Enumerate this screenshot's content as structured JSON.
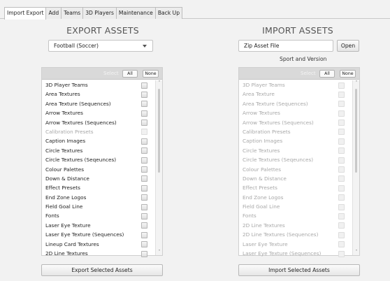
{
  "tabs": [
    "Import Export",
    "Add",
    "Teams",
    "3D Players",
    "Maintenance",
    "Back Up"
  ],
  "export": {
    "heading": "EXPORT ASSETS",
    "dropdown_value": "Football (Soccer)",
    "select_label": "Select",
    "all_label": "All",
    "none_label": "None",
    "items": [
      {
        "label": "3D Player Teams",
        "enabled": true
      },
      {
        "label": "Area Textures",
        "enabled": true
      },
      {
        "label": "Area Texture (Sequences)",
        "enabled": true
      },
      {
        "label": "Arrow Textures",
        "enabled": true
      },
      {
        "label": "Arrow Textures (Sequences)",
        "enabled": true
      },
      {
        "label": "Calibration Presets",
        "enabled": false
      },
      {
        "label": "Caption Images",
        "enabled": true
      },
      {
        "label": "Circle Textures",
        "enabled": true
      },
      {
        "label": "Circle Textures (Seqeunces)",
        "enabled": true
      },
      {
        "label": "Colour Palettes",
        "enabled": true
      },
      {
        "label": "Down & Distance",
        "enabled": true
      },
      {
        "label": "Effect Presets",
        "enabled": true
      },
      {
        "label": "End Zone Logos",
        "enabled": true
      },
      {
        "label": "Field Goal Line",
        "enabled": true
      },
      {
        "label": "Fonts",
        "enabled": true
      },
      {
        "label": "Laser Eye Texture",
        "enabled": true
      },
      {
        "label": "Laser Eye Texture (Sequences)",
        "enabled": true
      },
      {
        "label": "Lineup Card Textures",
        "enabled": true
      },
      {
        "label": "2D Line Textures",
        "enabled": true
      }
    ],
    "button": "Export Selected Assets"
  },
  "import": {
    "heading": "IMPORT ASSETS",
    "file_value": "Zip Asset File",
    "open_label": "Open",
    "sport_version_label": "Sport and Version",
    "select_label": "Select",
    "all_label": "All",
    "none_label": "None",
    "items": [
      {
        "label": "3D Player Teams",
        "enabled": false
      },
      {
        "label": "Area Texture",
        "enabled": false
      },
      {
        "label": "Area Texture (Sequences)",
        "enabled": false
      },
      {
        "label": "Arrow Textures",
        "enabled": false
      },
      {
        "label": "Arrow Textures (Sequences)",
        "enabled": false
      },
      {
        "label": "Calibration Presets",
        "enabled": false
      },
      {
        "label": "Caption Images",
        "enabled": false
      },
      {
        "label": "Circle Textures",
        "enabled": false
      },
      {
        "label": "Circle Textures (Seqeunces)",
        "enabled": false
      },
      {
        "label": "Colour Palettes",
        "enabled": false
      },
      {
        "label": "Down & Distance",
        "enabled": false
      },
      {
        "label": "Effect Presets",
        "enabled": false
      },
      {
        "label": "End Zone Logos",
        "enabled": false
      },
      {
        "label": "Field Goal Line",
        "enabled": false
      },
      {
        "label": "Fonts",
        "enabled": false
      },
      {
        "label": "2D Line Textures",
        "enabled": false
      },
      {
        "label": "2D Line Textures (Sequences)",
        "enabled": false
      },
      {
        "label": "Laser Eye Texture",
        "enabled": false
      },
      {
        "label": "Laser Eye Texture (Sequences)",
        "enabled": false
      }
    ],
    "button": "Import Selected Assets"
  }
}
